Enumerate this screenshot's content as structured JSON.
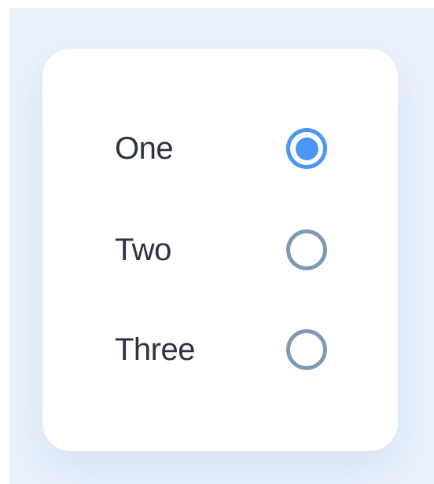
{
  "radio_group": {
    "options": [
      {
        "label": "One",
        "checked": true
      },
      {
        "label": "Two",
        "checked": false
      },
      {
        "label": "Three",
        "checked": false
      }
    ]
  },
  "colors": {
    "accent": "#4b95f5",
    "unchecked_ring": "#7f99b5",
    "label_text": "#2d3340",
    "background": "#eaf2fc",
    "card": "#ffffff"
  }
}
